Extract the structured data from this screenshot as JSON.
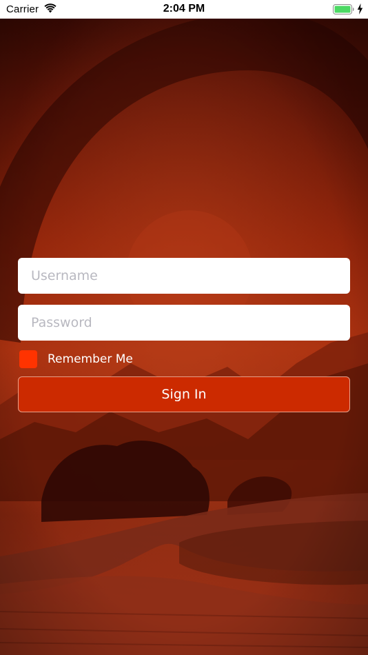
{
  "status_bar": {
    "carrier": "Carrier",
    "time": "2:04 PM",
    "wifi_icon": "wifi-icon",
    "battery_icon": "battery-full-icon",
    "charging_icon": "charging-bolt-icon"
  },
  "login": {
    "username": {
      "value": "",
      "placeholder": "Username"
    },
    "password": {
      "value": "",
      "placeholder": "Password"
    },
    "remember_me": {
      "label": "Remember Me",
      "checked": false
    },
    "sign_in_label": "Sign In"
  },
  "colors": {
    "overlay_tint": "#b32a08",
    "checkbox": "#ff3300",
    "button": "#cc2a00",
    "battery": "#4cd964"
  }
}
